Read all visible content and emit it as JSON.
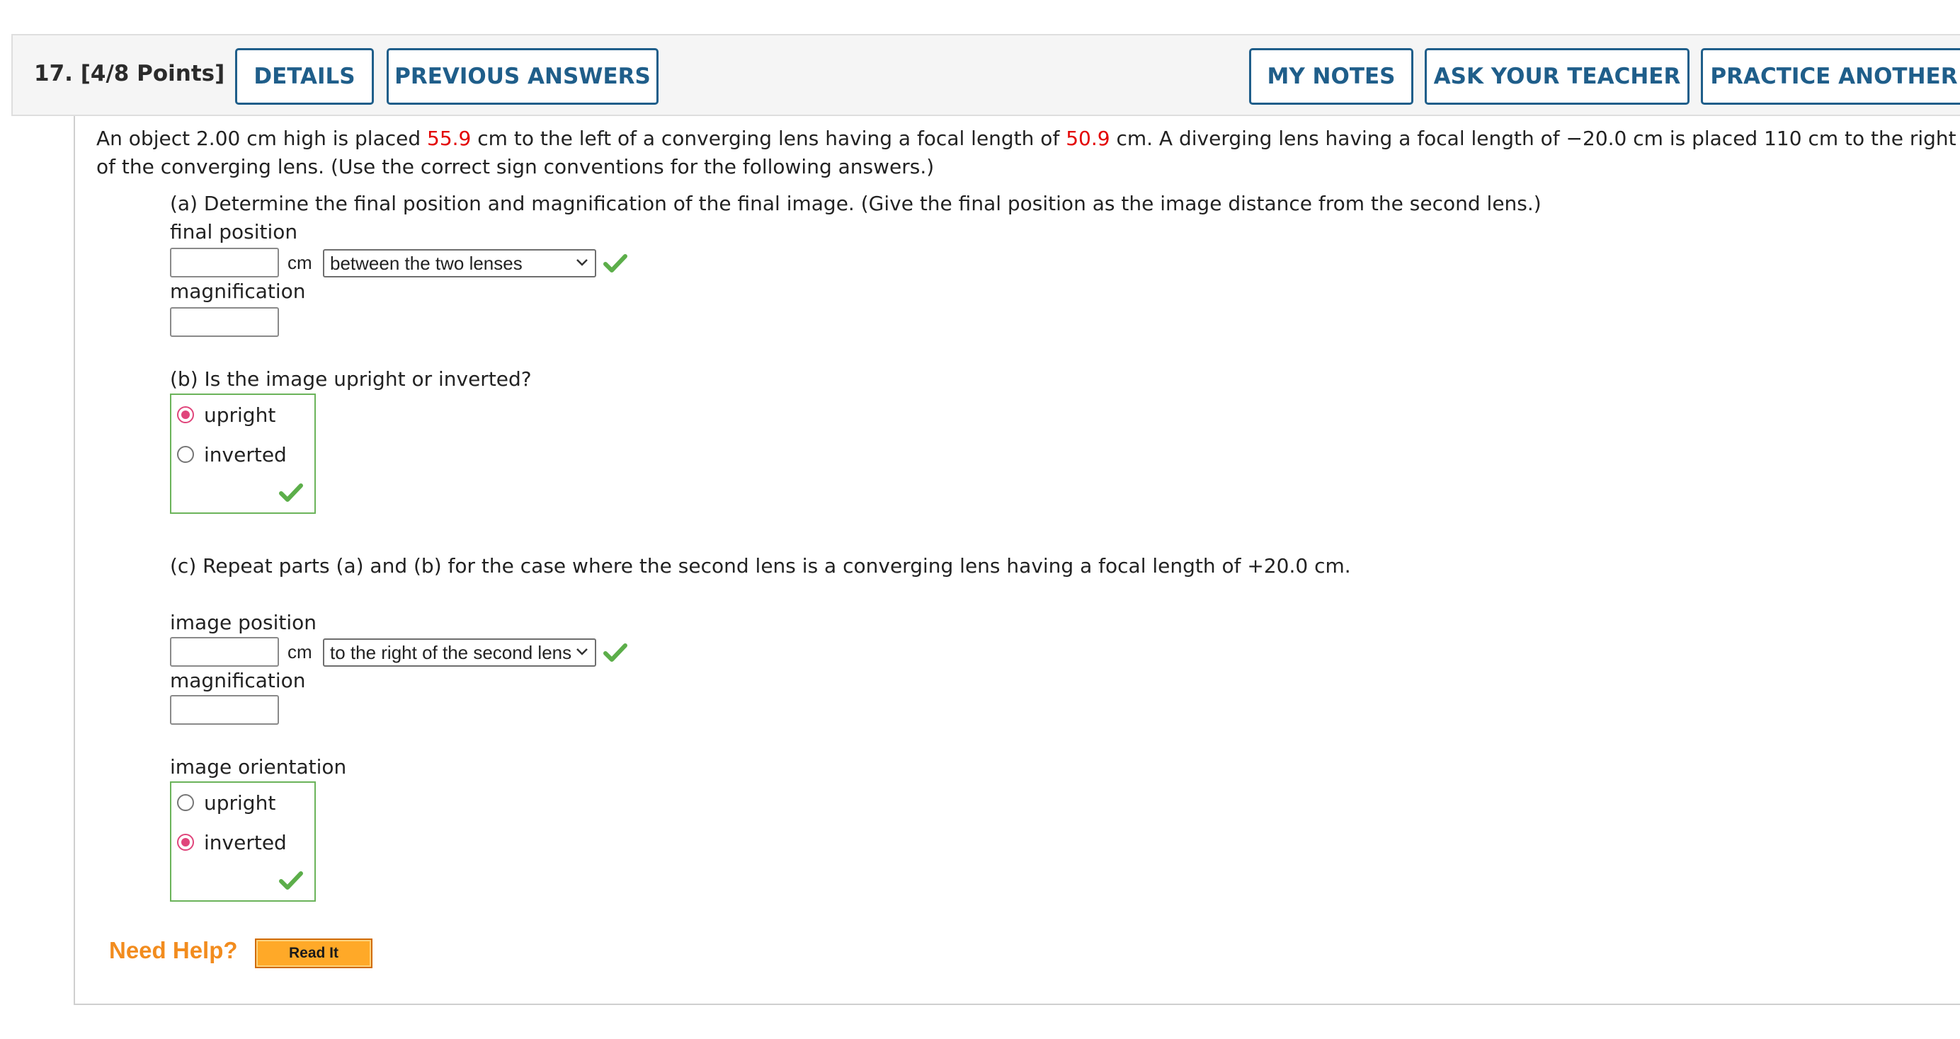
{
  "header": {
    "question_title": "17.  [4/8 Points]",
    "details_label": "DETAILS",
    "previous_answers_label": "PREVIOUS ANSWERS",
    "my_notes_label": "MY NOTES",
    "ask_teacher_label": "ASK YOUR TEACHER",
    "practice_another_label": "PRACTICE ANOTHER"
  },
  "question": {
    "intro_part1": "An object 2.00 cm high is placed ",
    "object_distance": "55.9",
    "intro_part2": " cm to the left of a converging lens having a focal length of ",
    "focal_length": "50.9",
    "intro_part3": " cm. A diverging lens having a focal length of −20.0 cm is placed 110 cm to the right of the converging lens. (Use the correct sign conventions for the following answers.)"
  },
  "part_a": {
    "prompt": "(a) Determine the final position and magnification of the final image. (Give the final position as the image distance from the second lens.)",
    "position_label": "final position",
    "position_value": "",
    "unit": "cm",
    "position_select": "between the two lenses",
    "magnification_label": "magnification",
    "magnification_value": ""
  },
  "part_b": {
    "prompt": "(b) Is the image upright or inverted?",
    "options": [
      "upright",
      "inverted"
    ],
    "selected": "upright"
  },
  "part_c": {
    "prompt": "(c) Repeat parts (a) and (b) for the case where the second lens is a converging lens having a focal length of +20.0 cm.",
    "position_label": "image position",
    "position_value": "",
    "unit": "cm",
    "position_select": "to the right of the second lens",
    "magnification_label": "magnification",
    "magnification_value": "",
    "orientation_label": "image orientation",
    "options": [
      "upright",
      "inverted"
    ],
    "selected": "inverted"
  },
  "help": {
    "need_help_label": "Need Help?",
    "read_it_label": "Read It"
  },
  "colors": {
    "accent": "#1f5e8a",
    "highlight_red": "#e30000",
    "correct_green": "#6bb35a",
    "radio_selected": "#e0457b",
    "help_orange": "#f28c1e"
  }
}
